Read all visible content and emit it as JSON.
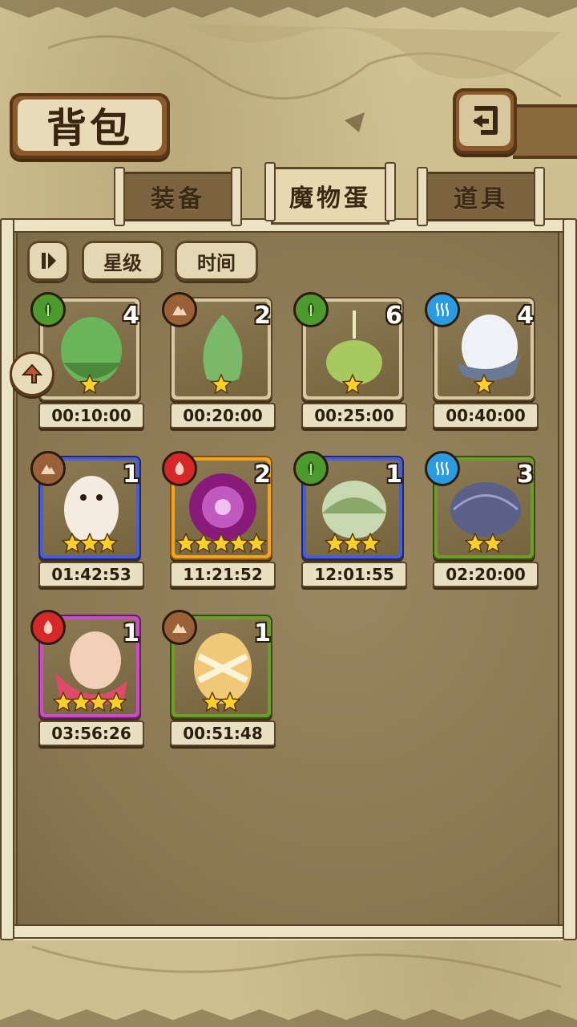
{
  "header": {
    "title": "背包",
    "back_icon": "return-icon"
  },
  "tabs": [
    {
      "label": "装备",
      "active": false
    },
    {
      "label": "魔物蛋",
      "active": true
    },
    {
      "label": "道具",
      "active": false
    }
  ],
  "sort": {
    "toggle_icon": "pause-sort-icon",
    "options": [
      "星级",
      "时间"
    ]
  },
  "colors": {
    "wood": "#4d9a2e",
    "earth": "#9a6038",
    "water": "#2a9be0",
    "fire": "#d62828",
    "star": "#ffd02a"
  },
  "eggs": [
    {
      "element": "wood",
      "count": "4",
      "stars": 1,
      "timer": "00:10:00",
      "frame": "plain"
    },
    {
      "element": "earth",
      "count": "2",
      "stars": 1,
      "timer": "00:20:00",
      "frame": "plain"
    },
    {
      "element": "wood",
      "count": "6",
      "stars": 1,
      "timer": "00:25:00",
      "frame": "plain"
    },
    {
      "element": "water",
      "count": "4",
      "stars": 1,
      "timer": "00:40:00",
      "frame": "plain"
    },
    {
      "element": "earth",
      "count": "1",
      "stars": 3,
      "timer": "01:42:53",
      "frame": "blue"
    },
    {
      "element": "fire",
      "count": "2",
      "stars": 5,
      "timer": "11:21:52",
      "frame": "gold"
    },
    {
      "element": "wood",
      "count": "1",
      "stars": 3,
      "timer": "12:01:55",
      "frame": "blue"
    },
    {
      "element": "water",
      "count": "3",
      "stars": 2,
      "timer": "02:20:00",
      "frame": "green"
    },
    {
      "element": "fire",
      "count": "1",
      "stars": 4,
      "timer": "03:56:26",
      "frame": "pink"
    },
    {
      "element": "earth",
      "count": "1",
      "stars": 2,
      "timer": "00:51:48",
      "frame": "green"
    }
  ]
}
